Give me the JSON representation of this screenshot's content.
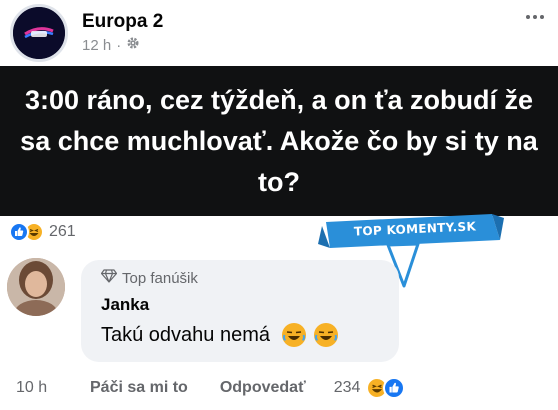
{
  "post": {
    "page_name": "Europa 2",
    "time": "12 h",
    "separator": "·",
    "text": "3:00 ráno, cez týždeň, a on ťa zobudí že sa chce muchlovať. Akože čo by si ty na to?",
    "reaction_count": "261"
  },
  "watermark": {
    "text": "TOP KOMENTY.SK"
  },
  "comment": {
    "badge": "Top fanúšik",
    "author": "Janka",
    "text": "Takú odvahu nemá",
    "time": "10 h",
    "like_label": "Páči sa mi to",
    "reply_label": "Odpovedať",
    "reaction_count": "234"
  },
  "colors": {
    "image_background": "#101112",
    "like_blue": "#1877f2",
    "haha_yellow": "#f7b125",
    "watermark_blue": "#2a8fd9",
    "bubble_gray": "#f0f2f5"
  },
  "icons": [
    "globe-settings-icon",
    "more-options-icon",
    "like-reaction-icon",
    "haha-reaction-icon",
    "diamond-icon",
    "laughing-emoji-icon"
  ]
}
